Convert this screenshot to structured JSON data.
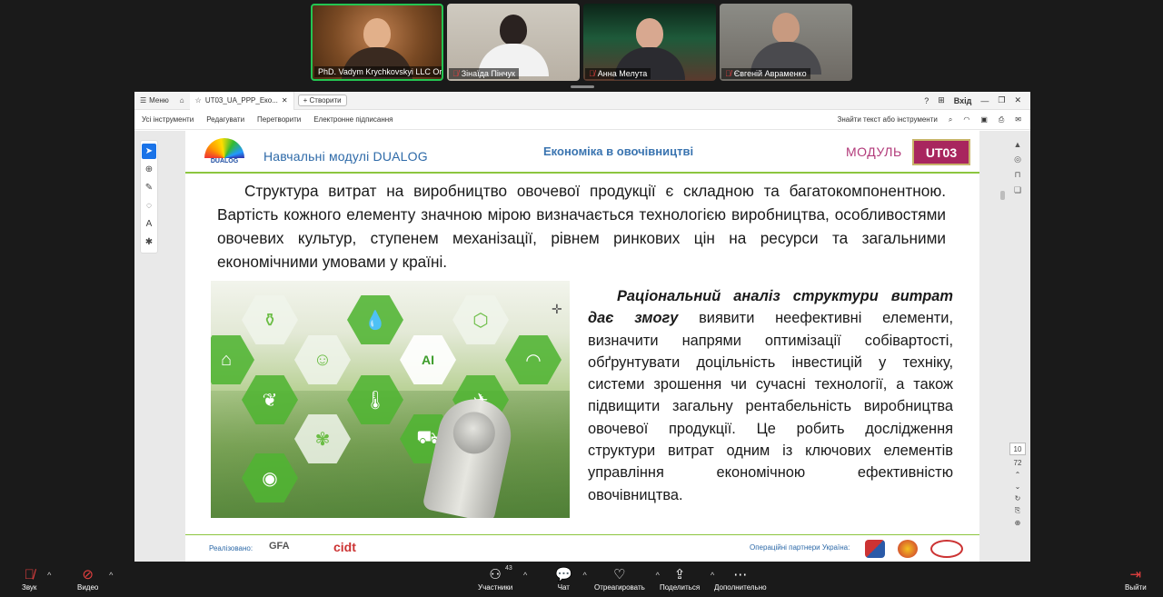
{
  "participants": [
    {
      "name": "PhD. Vadym Krychkovskyi LLC Orga...",
      "muted": false,
      "active": true
    },
    {
      "name": "Зінаїда Пінчук",
      "muted": true,
      "active": false
    },
    {
      "name": "Анна Мелута",
      "muted": true,
      "active": false
    },
    {
      "name": "Євгеній Авраменко",
      "muted": true,
      "active": false
    }
  ],
  "acrobat": {
    "menu_label": "Меню",
    "tab_title": "UT03_UA_PPP_Eко...",
    "new_tab_label": "Створити",
    "signin_label": "Вхід",
    "toolbar": [
      "Усі інструменти",
      "Редагувати",
      "Перетворити",
      "Електронне підписання"
    ],
    "search_placeholder": "Знайти текст або інструменти",
    "page_current": "10",
    "page_total": "72"
  },
  "slide": {
    "logo_text": "DUALOG",
    "header_title": "Навчальні модулі  DUALOG",
    "header_center": "Економіка в овочівництві",
    "modul_label": "МОДУЛЬ",
    "module_code": "UT03",
    "paragraph1": "Структура витрат на виробництво овочевої продукції є складною та багатокомпонентною. Вартість кожного елементу значною мірою визначається технологією виробництва, особливостями овочевих культур, ступенем механізації, рівнем ринкових цін на ресурси та загальними економічними умовами у країні.",
    "paragraph2_emphasis": "Раціональний аналіз структури витрат дає змогу",
    "paragraph2_rest": " виявити неефективні елементи, визначити напрями оптимізації собівартості, обґрунтувати доцільність інвестицій у техніку, системи зрошення чи сучасні технології, а також підвищити загальну рентабельність виробництва овочевої продукції. Це робить дослідження структури витрат одним із ключових елементів управління економічною ефективністю овочівництва.",
    "footer_implemented": "Реалізовано:",
    "footer_gfa": "GFA",
    "footer_cidt": "cidt",
    "footer_partners": "Операційні партнери Україна:"
  },
  "zoom_bar": {
    "audio_label": "Звук",
    "video_label": "Видео",
    "participants_label": "Участники",
    "participants_count": "43",
    "chat_label": "Чат",
    "react_label": "Отреагировать",
    "share_label": "Поделиться",
    "more_label": "Дополнительно",
    "leave_label": "Выйти"
  }
}
